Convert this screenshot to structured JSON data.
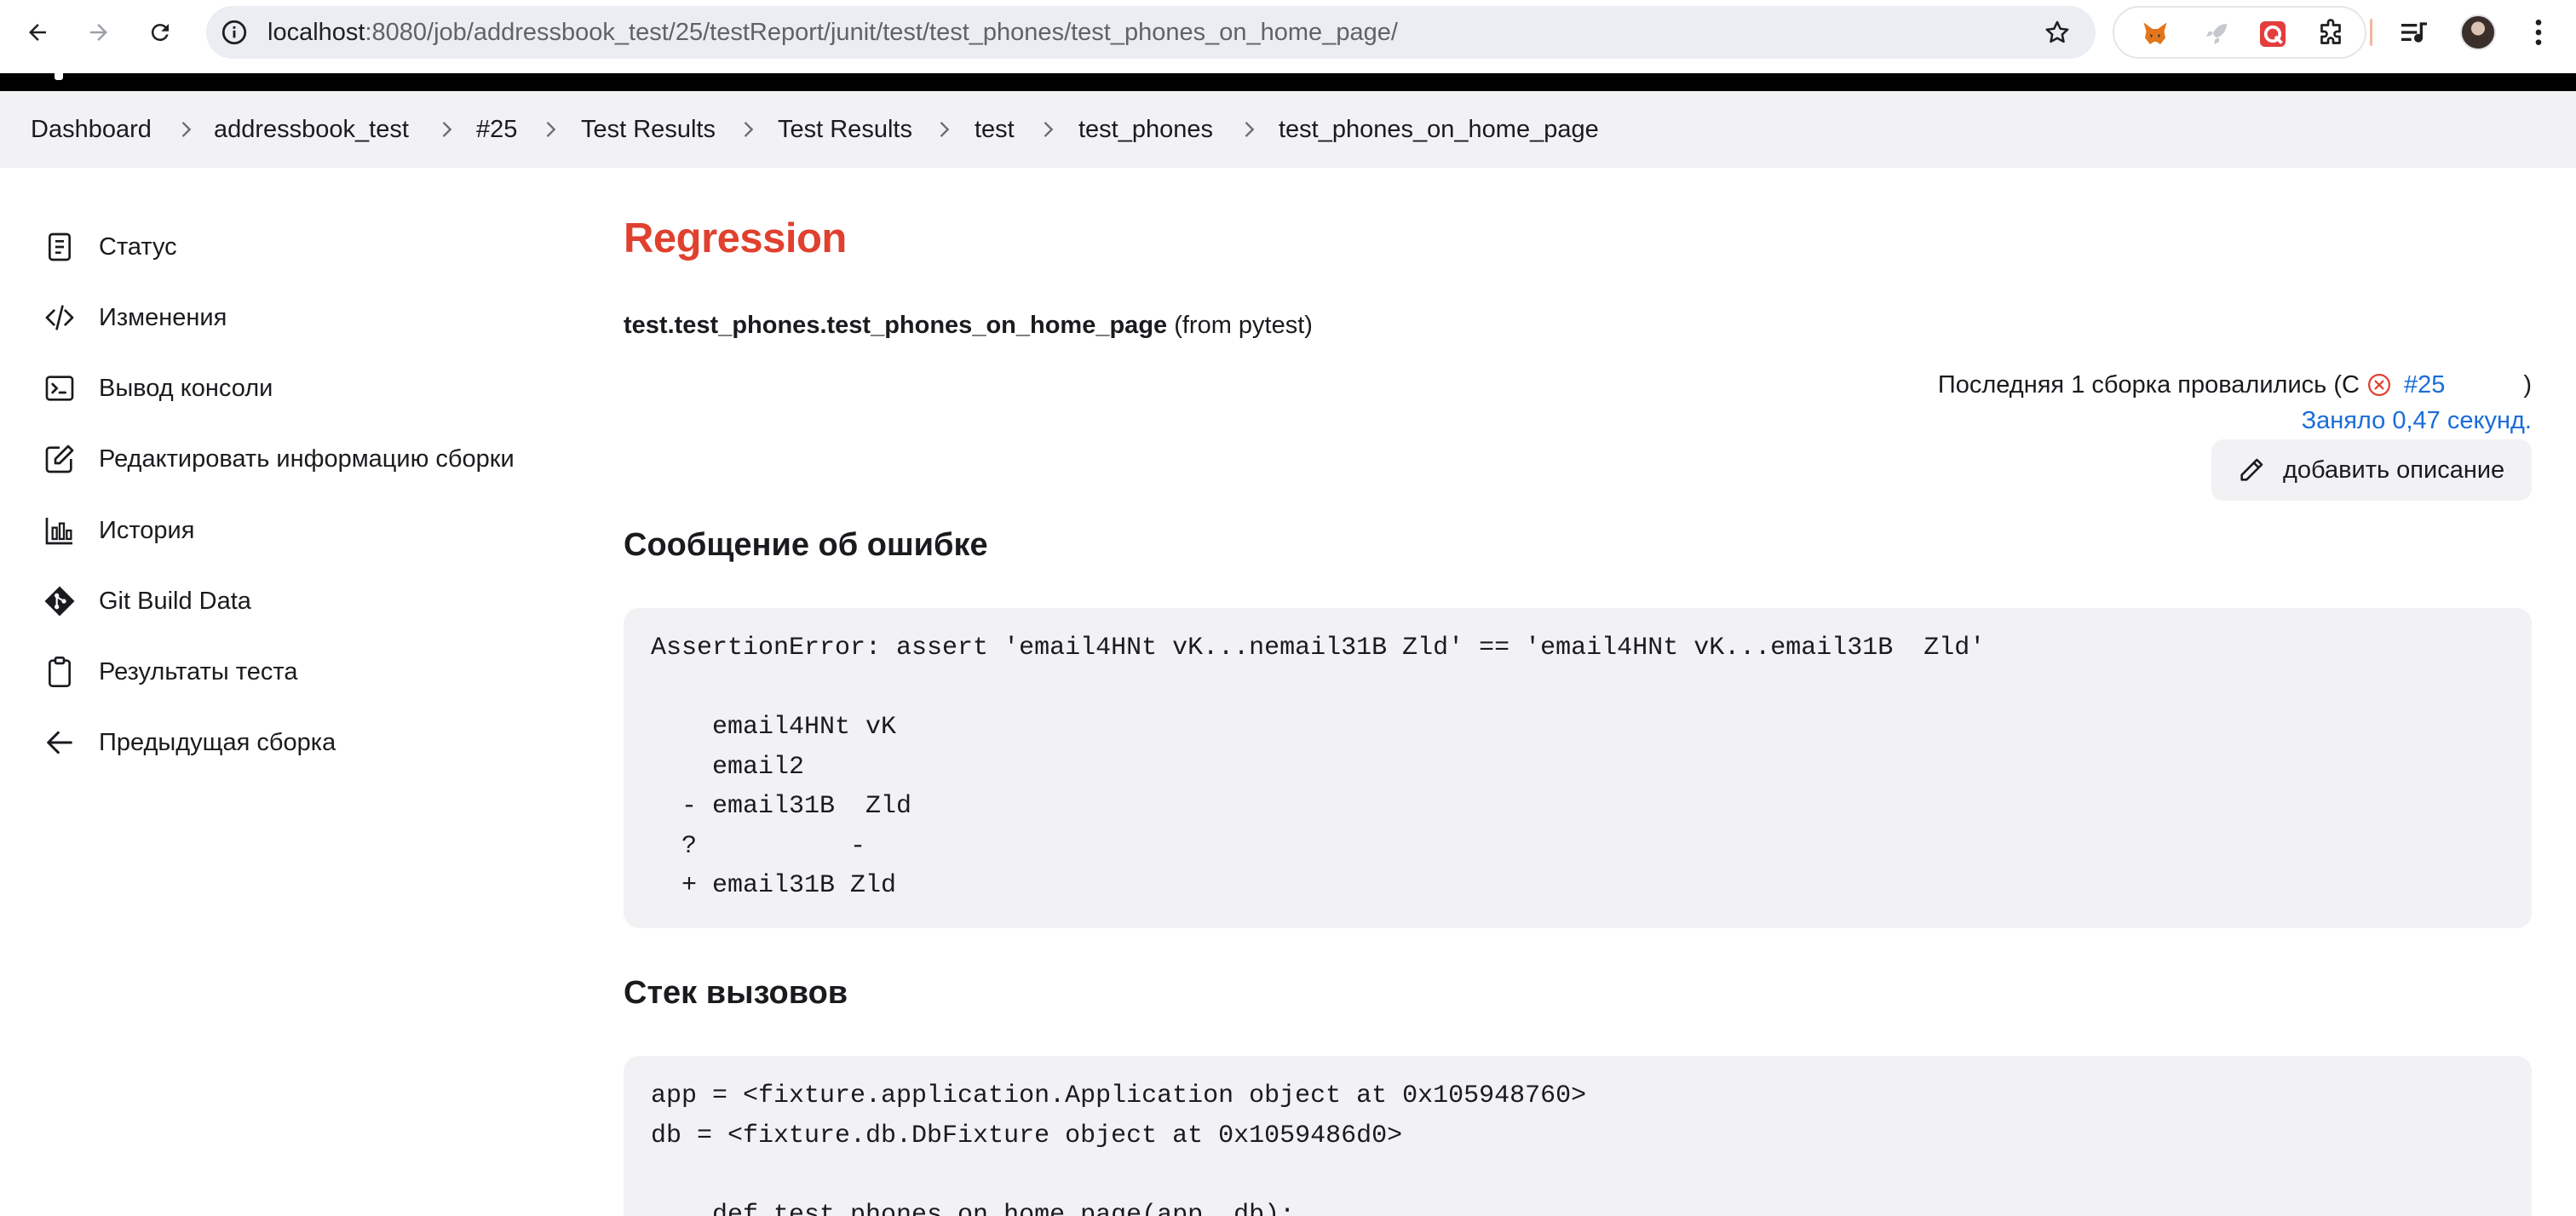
{
  "browser": {
    "url_host": "localhost",
    "url_path": ":8080/job/addressbook_test/25/testReport/junit/test/test_phones/test_phones_on_home_page/",
    "icons": [
      "back-icon",
      "forward-icon",
      "reload-icon",
      "site-info-icon",
      "bookmark-star-icon",
      "metamask-extension-icon",
      "rocket-extension-icon",
      "red-extension-icon",
      "extensions-puzzle-icon",
      "media-controls-icon",
      "profile-avatar",
      "more-menu-icon"
    ]
  },
  "breadcrumbs": [
    "Dashboard",
    "addressbook_test",
    "#25",
    "Test Results",
    "Test Results",
    "test",
    "test_phones",
    "test_phones_on_home_page"
  ],
  "sidebar": {
    "items": [
      {
        "label": "Статус",
        "icon": "status-document-icon"
      },
      {
        "label": "Изменения",
        "icon": "code-changes-icon"
      },
      {
        "label": "Вывод консоли",
        "icon": "terminal-icon"
      },
      {
        "label": "Редактировать информацию сборки",
        "icon": "edit-icon"
      },
      {
        "label": "История",
        "icon": "history-chart-icon"
      },
      {
        "label": "Git Build Data",
        "icon": "git-icon"
      },
      {
        "label": "Результаты теста",
        "icon": "clipboard-icon"
      },
      {
        "label": "Предыдущая сборка",
        "icon": "arrow-left-icon"
      }
    ]
  },
  "main": {
    "status_title": "Regression",
    "test_full_name": "test.test_phones.test_phones_on_home_page",
    "test_source": "(from pytest)",
    "failure_prefix": "Последняя 1 сборка провалились (С",
    "failure_build_link": "#25",
    "failure_suffix": ")",
    "duration": "Заняло 0,47 секунд.",
    "add_description_label": "добавить описание",
    "error_heading": "Сообщение об ошибке",
    "error_message": "AssertionError: assert 'email4HNt vK...nemail31B Zld' == 'email4HNt vK...email31B  Zld'\n\n    email4HNt vK\n    email2\n  - email31B  Zld\n  ?          -\n  + email31B Zld",
    "stack_heading": "Стек вызовов",
    "stack_trace": "app = <fixture.application.Application object at 0x105948760>\ndb = <fixture.db.DbFixture object at 0x1059486d0>\n\n    def test_phones_on_home_page(app, db):"
  },
  "colors": {
    "regression_red": "#e0412f",
    "link_blue": "#1a6cd9",
    "panel_gray": "#f2f2f4",
    "header_black": "#000000"
  }
}
